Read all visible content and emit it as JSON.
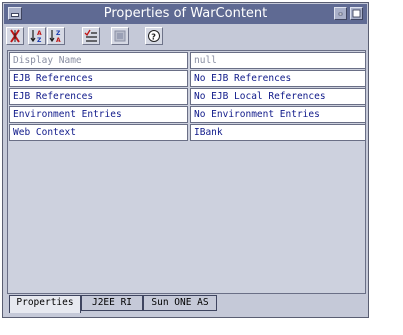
{
  "window": {
    "title": "Properties of WarContent"
  },
  "toolbar": {
    "buttons": [
      {
        "icon": "unsort-icon"
      },
      {
        "icon": "sort-ascending-icon"
      },
      {
        "icon": "sort-descending-icon"
      },
      {
        "icon": "checklist-icon"
      },
      {
        "icon": "disabled-property-icon"
      },
      {
        "icon": "help-icon"
      }
    ]
  },
  "properties": [
    {
      "name": "Display Name",
      "value": "null",
      "disabled": true
    },
    {
      "name": "EJB References",
      "value": "No EJB References",
      "disabled": false
    },
    {
      "name": "EJB References",
      "value": "No EJB Local References",
      "disabled": false
    },
    {
      "name": "Environment Entries",
      "value": "No Environment Entries",
      "disabled": false
    },
    {
      "name": "Web Context",
      "value": "IBank",
      "disabled": false
    }
  ],
  "tabs": [
    {
      "label": "Properties",
      "active": true
    },
    {
      "label": "J2EE RI",
      "active": false
    },
    {
      "label": "Sun ONE AS",
      "active": false
    }
  ],
  "colors": {
    "title_bar": "#5f6a93",
    "window_bg": "#c5c9d8",
    "text_enabled": "#101a8a",
    "text_disabled": "#8a8fa3"
  }
}
